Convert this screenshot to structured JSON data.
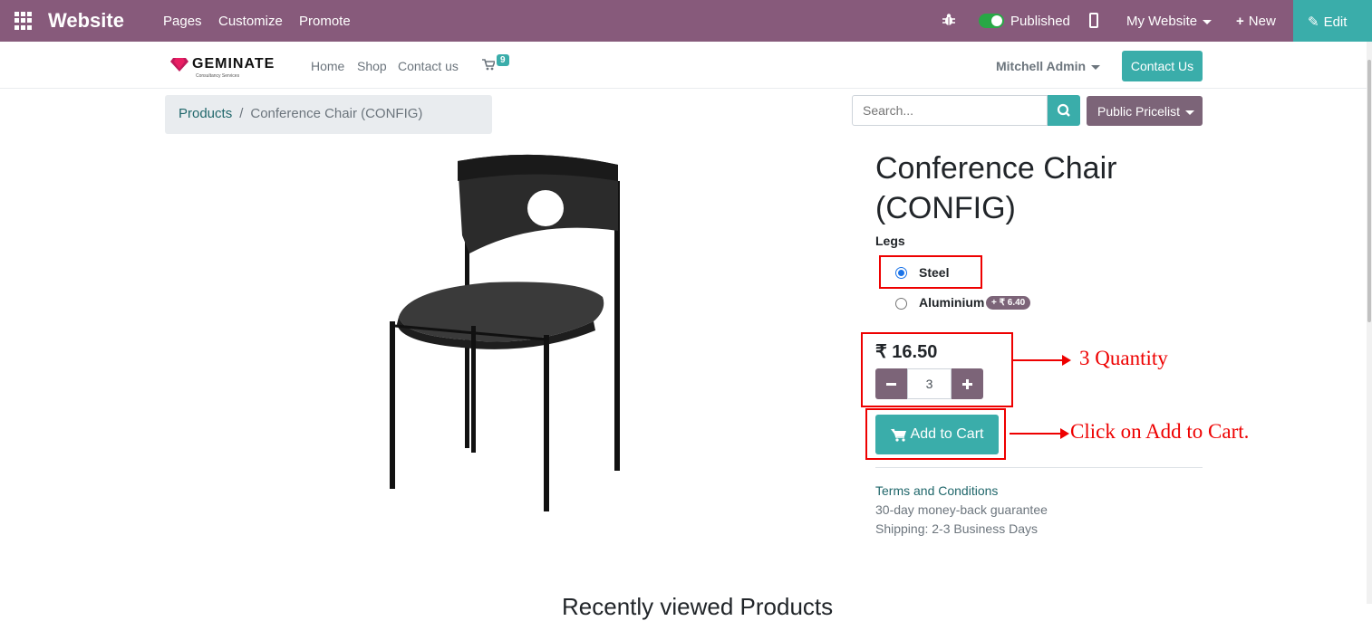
{
  "admin_bar": {
    "brand": "Website",
    "menu": [
      "Pages",
      "Customize",
      "Promote"
    ],
    "published_label": "Published",
    "my_website_label": "My Website",
    "new_label": "New",
    "edit_label": "Edit",
    "colors": {
      "bar": "#875a7b",
      "edit": "#3aadaa"
    }
  },
  "navbar": {
    "logo_text": "GEMINATE",
    "logo_subtitle": "Consultancy Services",
    "links": [
      "Home",
      "Shop",
      "Contact us"
    ],
    "cart_count": "9",
    "user_name": "Mitchell Admin",
    "contact_button": "Contact Us"
  },
  "breadcrumb": {
    "parent": "Products",
    "current": "Conference Chair (CONFIG)"
  },
  "search": {
    "placeholder": "Search...",
    "pricelist_label": "Public Pricelist"
  },
  "product": {
    "name": "Conference Chair (CONFIG)",
    "attribute_label": "Legs",
    "options": [
      {
        "label": "Steel",
        "selected": true,
        "extra": ""
      },
      {
        "label": "Aluminium",
        "selected": false,
        "extra": "+ ₹ 6.40"
      }
    ],
    "price": "₹ 16.50",
    "quantity": "3",
    "add_to_cart_label": "Add to Cart",
    "terms_label": "Terms and Conditions",
    "guarantee": "30-day money-back guarantee",
    "shipping": "Shipping: 2-3 Business Days"
  },
  "annotations": {
    "quantity_note": "3 Quantity",
    "cart_note": "Click on Add to Cart."
  },
  "section_heading": "Recently viewed Products"
}
